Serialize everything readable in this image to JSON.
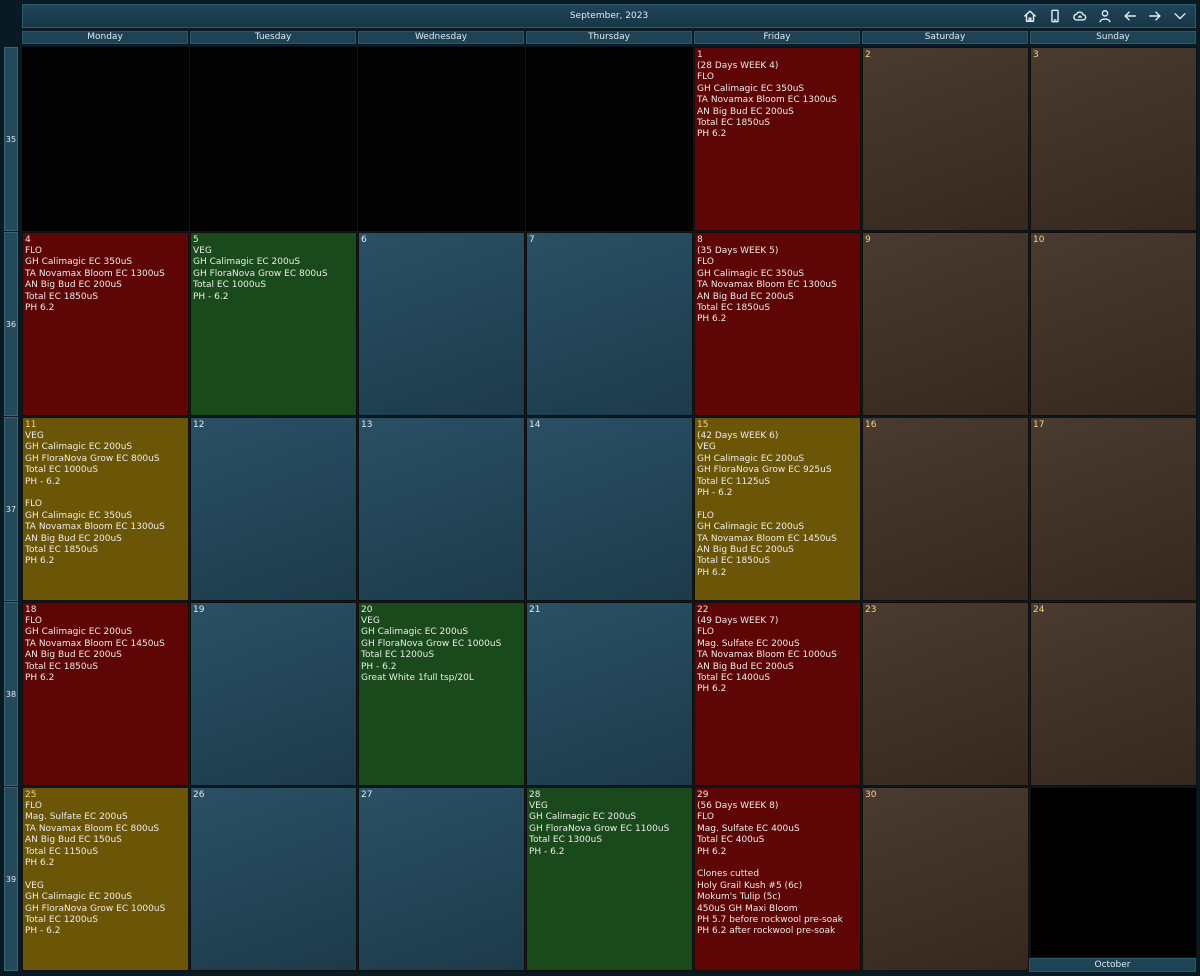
{
  "header": {
    "title": "September, 2023"
  },
  "weekdays": [
    "Monday",
    "Tuesday",
    "Wednesday",
    "Thursday",
    "Friday",
    "Saturday",
    "Sunday"
  ],
  "weeks": [
    {
      "number": "35",
      "days": [
        {
          "day": "",
          "color": "empty",
          "lines": ""
        },
        {
          "day": "",
          "color": "empty",
          "lines": ""
        },
        {
          "day": "",
          "color": "empty",
          "lines": ""
        },
        {
          "day": "",
          "color": "empty",
          "lines": ""
        },
        {
          "day": "1",
          "color": "red",
          "lines": "(28 Days WEEK 4)\nFLO\nGH Calimagic EC 350uS\nTA Novamax Bloom EC 1300uS\nAN Big Bud EC 200uS\nTotal EC 1850uS\nPH 6.2"
        },
        {
          "day": "2",
          "color": "brown",
          "lines": ""
        },
        {
          "day": "3",
          "color": "brown",
          "lines": ""
        }
      ]
    },
    {
      "number": "36",
      "days": [
        {
          "day": "4",
          "color": "red",
          "lines": "FLO\nGH Calimagic EC 350uS\nTA Novamax Bloom EC 1300uS\nAN Big Bud EC 200uS\nTotal EC 1850uS\nPH 6.2"
        },
        {
          "day": "5",
          "color": "green",
          "lines": "VEG\nGH Calimagic EC 200uS\nGH FloraNova Grow EC 800uS\nTotal EC 1000uS\nPH - 6.2"
        },
        {
          "day": "6",
          "color": "blue",
          "lines": ""
        },
        {
          "day": "7",
          "color": "blue",
          "lines": ""
        },
        {
          "day": "8",
          "color": "red",
          "lines": "(35 Days WEEK 5)\nFLO\nGH Calimagic EC 350uS\nTA Novamax Bloom EC 1300uS\nAN Big Bud EC 200uS\nTotal EC 1850uS\nPH 6.2"
        },
        {
          "day": "9",
          "color": "brown",
          "lines": ""
        },
        {
          "day": "10",
          "color": "brown",
          "lines": ""
        }
      ]
    },
    {
      "number": "37",
      "days": [
        {
          "day": "11",
          "color": "yellow",
          "lines": "VEG\nGH Calimagic EC 200uS\nGH FloraNova Grow EC 800uS\nTotal EC 1000uS\nPH - 6.2\n\nFLO\nGH Calimagic EC 350uS\nTA Novamax Bloom EC 1300uS\nAN Big Bud EC 200uS\nTotal EC 1850uS\nPH 6.2"
        },
        {
          "day": "12",
          "color": "blue",
          "lines": ""
        },
        {
          "day": "13",
          "color": "blue",
          "lines": ""
        },
        {
          "day": "14",
          "color": "blue",
          "lines": ""
        },
        {
          "day": "15",
          "color": "yellow",
          "lines": "(42 Days WEEK 6)\nVEG\nGH Calimagic EC 200uS\nGH FloraNova Grow EC 925uS\nTotal EC 1125uS\nPH - 6.2\n\nFLO\nGH Calimagic EC 200uS\nTA Novamax Bloom EC 1450uS\nAN Big Bud EC 200uS\nTotal EC 1850uS\nPH 6.2"
        },
        {
          "day": "16",
          "color": "brown",
          "lines": ""
        },
        {
          "day": "17",
          "color": "brown",
          "lines": ""
        }
      ]
    },
    {
      "number": "38",
      "days": [
        {
          "day": "18",
          "color": "red",
          "lines": "FLO\nGH Calimagic EC 200uS\nTA Novamax Bloom EC 1450uS\nAN Big Bud EC 200uS\nTotal EC 1850uS\nPH 6.2"
        },
        {
          "day": "19",
          "color": "blue",
          "lines": ""
        },
        {
          "day": "20",
          "color": "green",
          "lines": "VEG\nGH Calimagic EC 200uS\nGH FloraNova Grow EC 1000uS\nTotal EC 1200uS\nPH - 6.2\nGreat White 1full tsp/20L"
        },
        {
          "day": "21",
          "color": "blue",
          "lines": ""
        },
        {
          "day": "22",
          "color": "red",
          "lines": "(49 Days WEEK 7)\nFLO\nMag. Sulfate EC 200uS\nTA Novamax Bloom EC 1000uS\nAN Big Bud EC 200uS\nTotal EC 1400uS\nPH 6.2"
        },
        {
          "day": "23",
          "color": "brown",
          "lines": ""
        },
        {
          "day": "24",
          "color": "brown",
          "lines": ""
        }
      ]
    },
    {
      "number": "39",
      "days": [
        {
          "day": "25",
          "color": "yellow",
          "lines": "FLO\nMag. Sulfate EC 200uS\nTA Novamax Bloom EC 800uS\nAN Big Bud EC 150uS\nTotal EC 1150uS\nPH 6.2\n\nVEG\nGH Calimagic EC 200uS\nGH FloraNova Grow EC 1000uS\nTotal EC 1200uS\nPH - 6.2"
        },
        {
          "day": "26",
          "color": "blue",
          "lines": ""
        },
        {
          "day": "27",
          "color": "blue",
          "lines": ""
        },
        {
          "day": "28",
          "color": "green",
          "lines": "VEG\nGH Calimagic EC 200uS\nGH FloraNova Grow EC 1100uS\nTotal EC 1300uS\nPH - 6.2"
        },
        {
          "day": "29",
          "color": "red",
          "lines": "(56 Days WEEK 8)\nFLO\nMag. Sulfate EC 400uS\nTotal EC 400uS\nPH 6.2\n\nClones cutted\nHoly Grail Kush #5 (6c)\nMokum's Tulip (5c)\n450uS GH Maxi Bloom\nPH 5.7 before rockwool pre-soak\nPH 6.2 after rockwool pre-soak"
        },
        {
          "day": "30",
          "color": "brown",
          "lines": ""
        },
        {
          "day": "",
          "color": "black",
          "lines": ""
        }
      ]
    }
  ],
  "next_month_label": "October",
  "colors": {
    "red": "#5e0505",
    "green": "#1a4a1b",
    "yellow": "#6b5608",
    "blue": "#244a5d",
    "brown": "#43352b",
    "header": "#1d4355"
  },
  "icons": [
    "home-icon",
    "phone-icon",
    "sync-icon",
    "user-icon",
    "arrow-left-icon",
    "arrow-right-icon",
    "chevron-down-icon"
  ]
}
